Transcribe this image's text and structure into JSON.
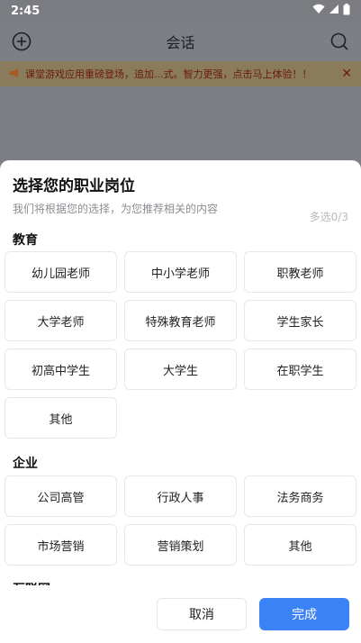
{
  "status": {
    "time": "2:45"
  },
  "appbar": {
    "title": "会话"
  },
  "banner": {
    "text": "课堂游戏应用重磅登场，追加...式。智力更强，点击马上体验！！",
    "close": "✕"
  },
  "sheet": {
    "title": "选择您的职业岗位",
    "subtitle": "我们将根据您的选择，为您推荐相关的内容",
    "count": "多选0/3",
    "groups": [
      {
        "title": "教育",
        "options": [
          "幼儿园老师",
          "中小学老师",
          "职教老师",
          "大学老师",
          "特殊教育老师",
          "学生家长",
          "初高中学生",
          "大学生",
          "在职学生",
          "其他"
        ]
      },
      {
        "title": "企业",
        "options": [
          "公司高管",
          "行政人事",
          "法务商务",
          "市场营销",
          "营销策划",
          "其他"
        ]
      },
      {
        "title": "互联网"
      }
    ]
  },
  "footer": {
    "cancel": "取消",
    "done": "完成"
  },
  "colors": {
    "primary": "#3b82f6",
    "banner_text": "#6b1a0f"
  }
}
